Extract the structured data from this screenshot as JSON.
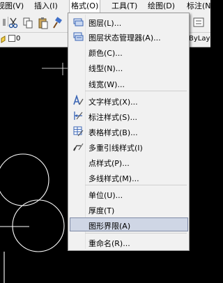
{
  "menubar": {
    "items": [
      "视图(V)",
      "插入(I)",
      "格式(O)",
      "工具(T)",
      "绘图(D)",
      "标注(N"
    ]
  },
  "toolbar": {
    "layer_value": "0",
    "linetype_value": "ByLaye"
  },
  "format_menu": {
    "items": [
      "图层(L)...",
      "图层状态管理器(A)...",
      "颜色(C)...",
      "线型(N)...",
      "线宽(W)...",
      "文字样式(X)...",
      "标注样式(S)...",
      "表格样式(B)...",
      "多重引线样式(I)",
      "点样式(P)...",
      "多线样式(M)...",
      "单位(U)...",
      "厚度(T)",
      "图形界限(A)",
      "重命名(R)..."
    ],
    "highlighted": "图形界限(A)"
  },
  "colors": {
    "canvas": "#000000",
    "menu_bg": "#f1f1f1",
    "highlight": "#cfd6e5"
  }
}
